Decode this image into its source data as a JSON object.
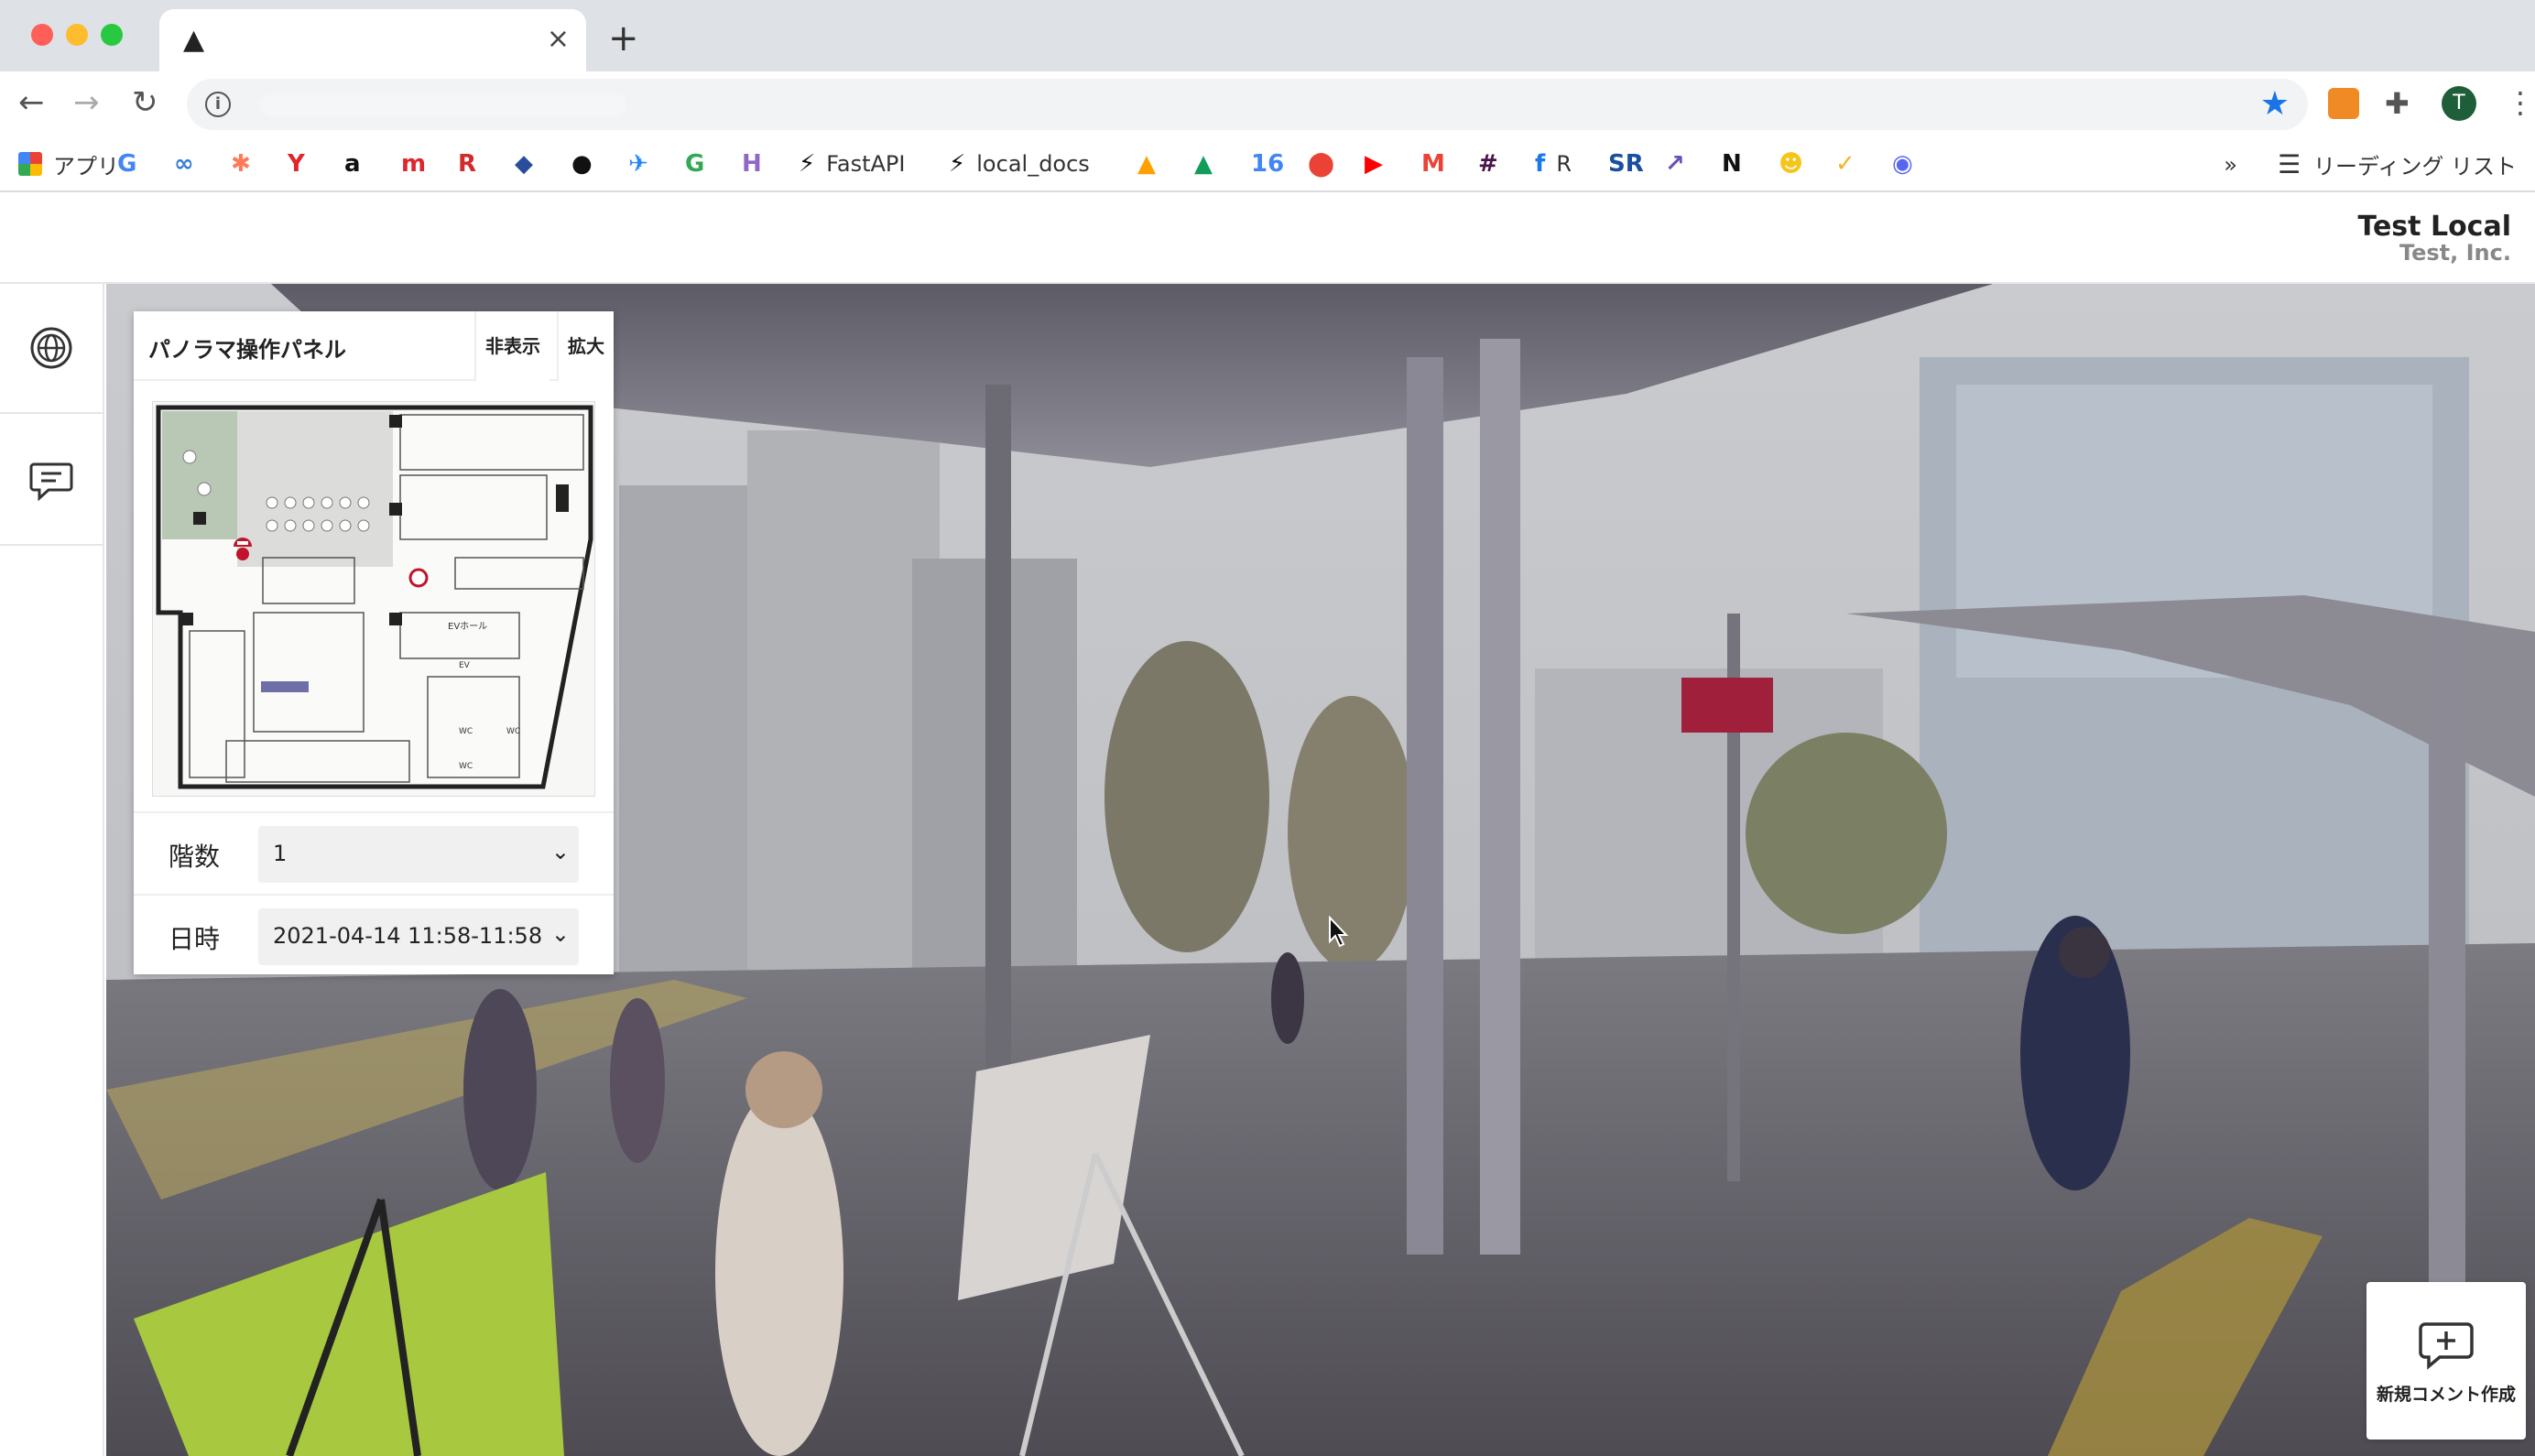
{
  "browser": {
    "tab": {
      "favicon": "▲",
      "title": ""
    },
    "url": "",
    "bookmarks": [
      {
        "label": "アプリ",
        "icon": "apps-grid-icon",
        "color": "#4285f4"
      },
      {
        "label": "",
        "icon": "google-icon",
        "color": "#4285f4",
        "glyph": "G"
      },
      {
        "label": "",
        "icon": "infinity-icon",
        "color": "#3a7bd5",
        "glyph": "∞"
      },
      {
        "label": "",
        "icon": "hubspot-icon",
        "color": "#ff7a59",
        "glyph": "✱"
      },
      {
        "label": "",
        "icon": "y-icon",
        "color": "#e0252b",
        "glyph": "Y"
      },
      {
        "label": "",
        "icon": "amazon-icon",
        "color": "#111111",
        "glyph": "a"
      },
      {
        "label": "",
        "icon": "m-icon",
        "color": "#e0252b",
        "glyph": "m"
      },
      {
        "label": "",
        "icon": "rs-icon",
        "color": "#d22b2b",
        "glyph": "R"
      },
      {
        "label": "",
        "icon": "bird-icon",
        "color": "#2a4d9b",
        "glyph": "◆"
      },
      {
        "label": "",
        "icon": "github-icon",
        "color": "#111111",
        "glyph": "●"
      },
      {
        "label": "",
        "icon": "jira-icon",
        "color": "#2684ff",
        "glyph": "✈"
      },
      {
        "label": "",
        "icon": "google-icon",
        "color": "#34a853",
        "glyph": "G"
      },
      {
        "label": "",
        "icon": "h-icon",
        "color": "#8e67c7",
        "glyph": "H"
      },
      {
        "label": "FastAPI",
        "icon": "bolt-icon",
        "color": "#111111",
        "glyph": "⚡"
      },
      {
        "label": "local_docs",
        "icon": "bolt-icon",
        "color": "#111111",
        "glyph": "⚡"
      },
      {
        "label": "",
        "icon": "firebase-icon",
        "color": "#ffa000",
        "glyph": "▲"
      },
      {
        "label": "",
        "icon": "drive-icon",
        "color": "#0f9d58",
        "glyph": "▲"
      },
      {
        "label": "",
        "icon": "calendar-icon",
        "color": "#4285f4",
        "glyph": "16"
      },
      {
        "label": "",
        "icon": "maps-icon",
        "color": "#ea4335",
        "glyph": "⬤"
      },
      {
        "label": "",
        "icon": "youtube-icon",
        "color": "#ff0000",
        "glyph": "▶"
      },
      {
        "label": "",
        "icon": "gmail-icon",
        "color": "#ea4335",
        "glyph": "M"
      },
      {
        "label": "",
        "icon": "slack-icon",
        "color": "#4a154b",
        "glyph": "#"
      },
      {
        "label": "R",
        "icon": "facebook-icon",
        "color": "#1877f2",
        "glyph": "f"
      },
      {
        "label": "",
        "icon": "sr-icon",
        "color": "#1a4fa0",
        "glyph": "SR"
      },
      {
        "label": "",
        "icon": "chart-icon",
        "color": "#6b4fbb",
        "glyph": "↗"
      },
      {
        "label": "",
        "icon": "notion-icon",
        "color": "#111111",
        "glyph": "N"
      },
      {
        "label": "",
        "icon": "smile-icon",
        "color": "#f5c518",
        "glyph": "☻"
      },
      {
        "label": "",
        "icon": "check-icon",
        "color": "#f0b429",
        "glyph": "✓"
      },
      {
        "label": "",
        "icon": "discord-icon",
        "color": "#5865f2",
        "glyph": "◉"
      }
    ],
    "overflow": "»",
    "reading_list": "リーディング リスト",
    "profile_initial": "T"
  },
  "header": {
    "company_name": "Test Local",
    "company_sub": "Test, Inc."
  },
  "panel": {
    "title": "パノラマ操作パネル",
    "hide_label": "非表示",
    "expand_label": "拡大",
    "floor_label": "階数",
    "floor_value": "1",
    "datetime_label": "日時",
    "datetime_value": "2021-04-14 11:58-11:58",
    "floorplan_labels": [
      "EVホール",
      "EV",
      "WC",
      "WC",
      "WC"
    ]
  },
  "new_comment": {
    "label": "新規コメント作成"
  }
}
